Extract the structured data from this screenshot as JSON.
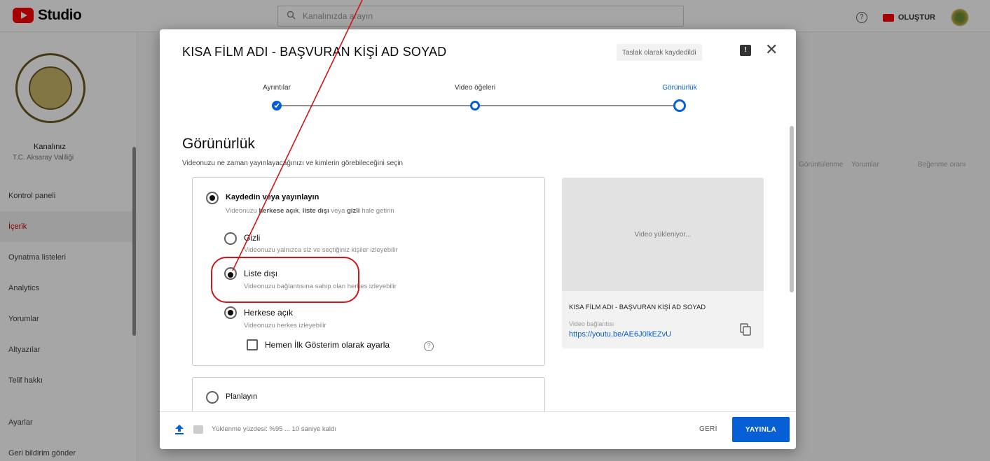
{
  "app": {
    "logo_text": "Studio",
    "search_placeholder": "Kanalınızda arayın",
    "help_glyph": "?",
    "create_label": "OLUŞTUR"
  },
  "sidebar": {
    "channel_name": "Kanalınız",
    "channel_sub": "T.C. Aksaray Valiliği",
    "items": [
      {
        "label": "Kontrol paneli"
      },
      {
        "label": "İçerik"
      },
      {
        "label": "Oynatma listeleri"
      },
      {
        "label": "Analytics"
      },
      {
        "label": "Yorumlar"
      },
      {
        "label": "Altyazılar"
      },
      {
        "label": "Telif hakkı"
      },
      {
        "label": "Ayarlar"
      },
      {
        "label": "Geri bildirim gönder"
      }
    ]
  },
  "background_columns": [
    "Görüntülenme",
    "Yorumlar",
    "Beğenme oranı"
  ],
  "dialog": {
    "title": "KISA FİLM ADI - BAŞVURAN KİŞİ AD SOYAD",
    "draft_badge": "Taslak olarak kaydedildi",
    "feedback_glyph": "!",
    "close_glyph": "✕",
    "steps": [
      {
        "label": "Ayrıntılar"
      },
      {
        "label": "Video öğeleri"
      },
      {
        "label": "Görünürlük"
      }
    ],
    "visibility": {
      "title": "Görünürlük",
      "desc": "Videonuzu ne zaman yayınlayacağınızı ve kimlerin görebileceğini seçin",
      "save_publish": {
        "label": "Kaydedin veya yayınlayın",
        "desc_prefix": "Videonuzu",
        "desc_public": "herkese açık",
        "desc_unlisted": "liste dışı",
        "desc_mid": "veya",
        "desc_private": "gizli",
        "desc_suffix": "hale getirin"
      },
      "options": [
        {
          "label": "Gizli",
          "desc": "Videonuzu yalnızca siz ve seçtiğiniz kişiler izleyebilir"
        },
        {
          "label": "Liste dışı",
          "desc": "Videonuzu bağlantısına sahip olan herkes izleyebilir"
        },
        {
          "label": "Herkese açık",
          "desc": "Videonuzu herkes izleyebilir"
        }
      ],
      "premiere_label": "Hemen İlk Gösterim olarak ayarla",
      "premiere_help_glyph": "?",
      "schedule_label": "Planlayın"
    },
    "preview": {
      "status": "Video yükleniyor...",
      "title": "KISA FİLM ADI - BAŞVURAN KİŞİ AD SOYAD",
      "link_label": "Video bağlantısı",
      "link": "https://youtu.be/AE6J0lkEZvU"
    },
    "footer": {
      "upload_status": "Yüklenme yüzdesi: %95 ... 10 saniye kaldı",
      "back_label": "GERİ",
      "publish_label": "YAYINLA"
    }
  },
  "colors": {
    "accent": "#065fd4",
    "highlight": "#d01616",
    "brand": "#ff0000"
  }
}
